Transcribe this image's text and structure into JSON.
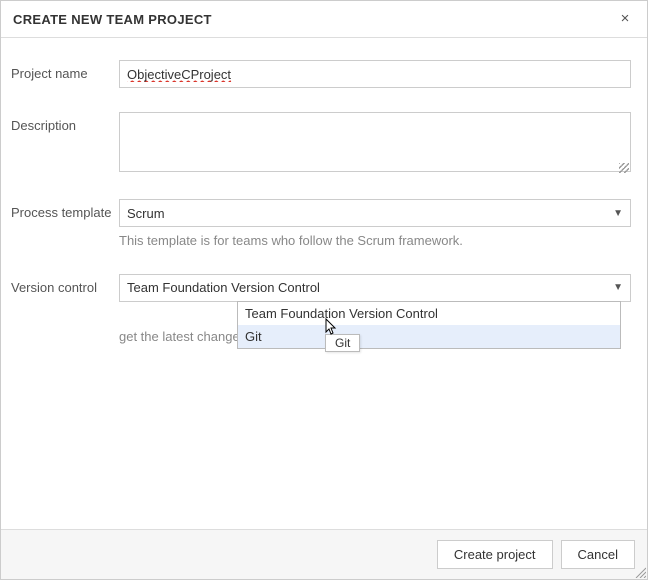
{
  "dialog": {
    "title": "CREATE NEW TEAM PROJECT"
  },
  "labels": {
    "project_name": "Project name",
    "description": "Description",
    "process_template": "Process template",
    "version_control": "Version control"
  },
  "fields": {
    "project_name_value": "ObjectiveCProject",
    "description_value": "",
    "process_template_selected": "Scrum",
    "process_template_help": "This template is for teams who follow the Scrum framework.",
    "version_control_selected": "Team Foundation Version Control",
    "version_control_help_fragment": "get the latest changes.",
    "version_control_options": [
      "Team Foundation Version Control",
      "Git"
    ],
    "vc_option_0": "Team Foundation Version Control",
    "vc_option_1": "Git",
    "tooltip": "Git"
  },
  "buttons": {
    "create": "Create project",
    "cancel": "Cancel"
  }
}
